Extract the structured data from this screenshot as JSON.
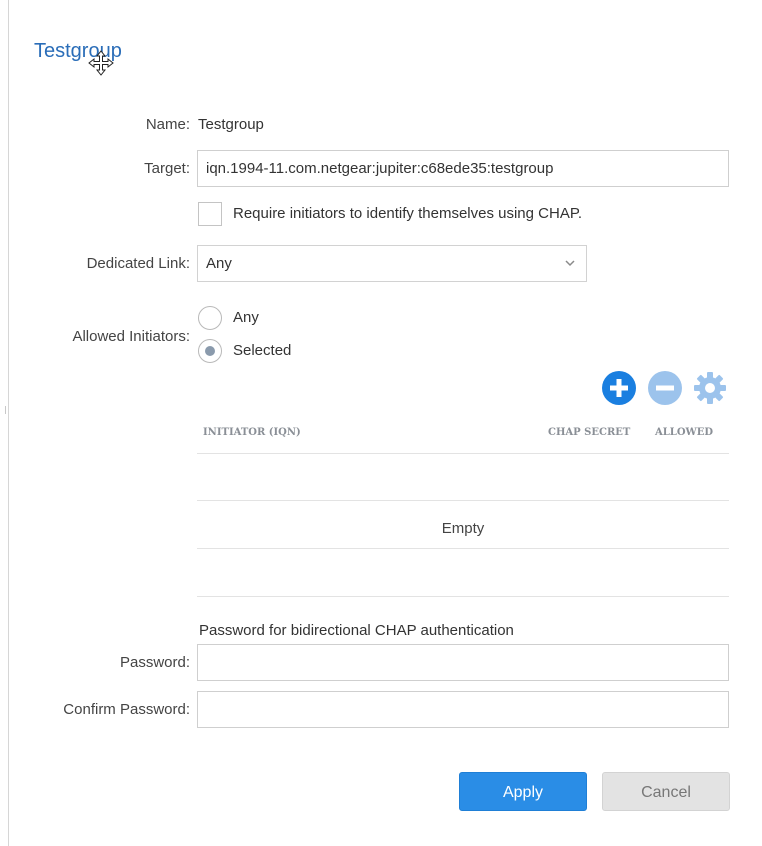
{
  "title": "Testgroup",
  "form": {
    "name_label": "Name:",
    "name_value": "Testgroup",
    "target_label": "Target:",
    "target_value": "iqn.1994-11.com.netgear:jupiter:c68ede35:testgroup",
    "chap_checkbox_label": "Require initiators to identify themselves using CHAP.",
    "chap_checked": false,
    "dedicated_link_label": "Dedicated Link:",
    "dedicated_link_value": "Any",
    "allowed_initiators_label": "Allowed Initiators:",
    "radio_options": [
      {
        "label": "Any",
        "selected": false
      },
      {
        "label": "Selected",
        "selected": true
      }
    ]
  },
  "table": {
    "columns": [
      "INITIATOR (IQN)",
      "CHAP SECRET",
      "ALLOWED"
    ],
    "empty_text": "Empty",
    "toolbar_icons": [
      "add-icon",
      "remove-icon",
      "settings-icon"
    ]
  },
  "bidirectional": {
    "heading": "Password for bidirectional CHAP authentication",
    "password_label": "Password:",
    "password_value": "",
    "confirm_label": "Confirm Password:",
    "confirm_value": ""
  },
  "buttons": {
    "apply": "Apply",
    "cancel": "Cancel"
  },
  "colors": {
    "accent": "#2a8de6",
    "title": "#2a6db8",
    "icon_add": "#1a7fe0",
    "icon_muted": "#9cc3ec"
  }
}
